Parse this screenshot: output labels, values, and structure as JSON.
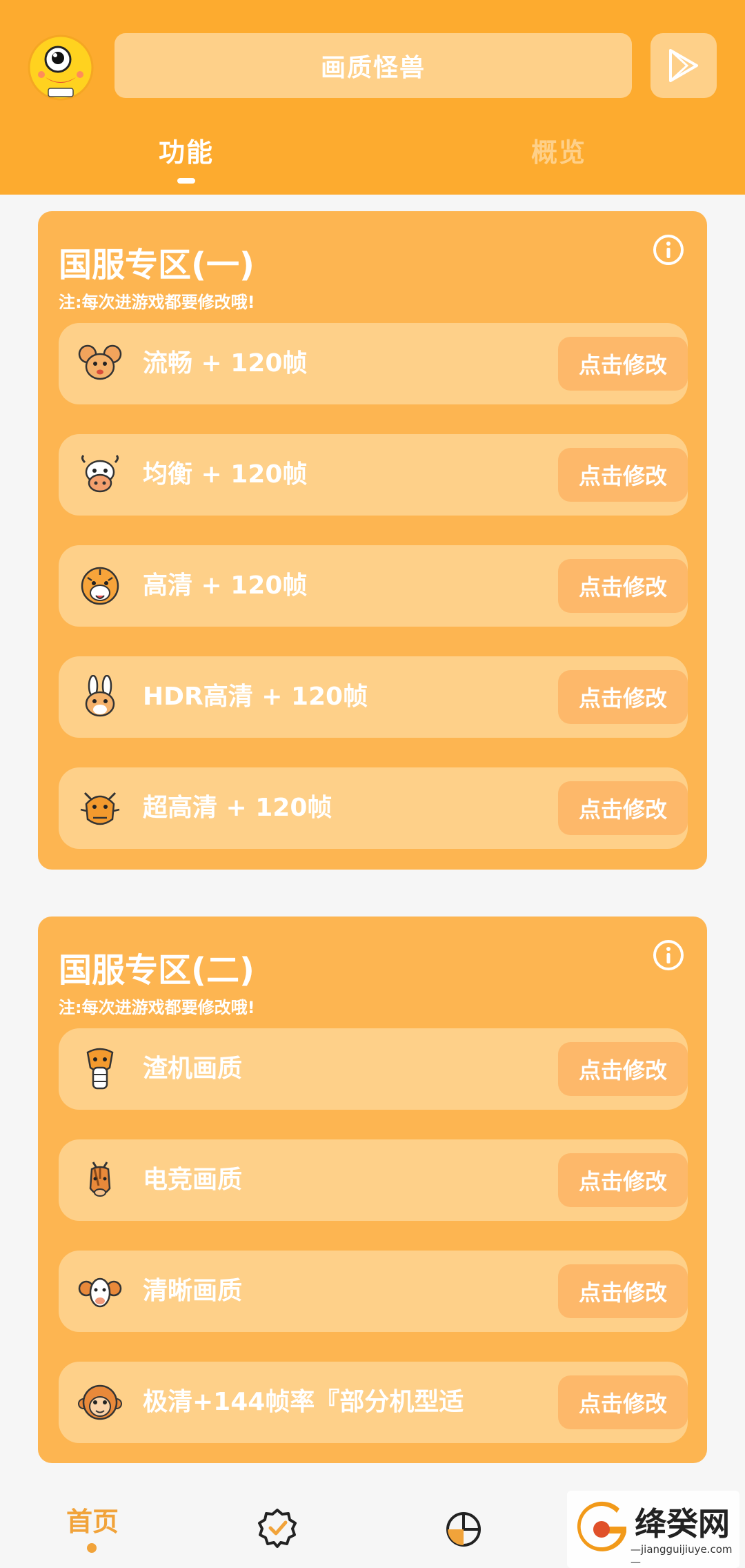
{
  "header": {
    "title": "画质怪兽",
    "tabs": [
      {
        "label": "功能",
        "active": true
      },
      {
        "label": "概览",
        "active": false
      }
    ],
    "accent_color": "#fdab2f"
  },
  "sections": [
    {
      "title": "国服专区(一)",
      "note": "注:每次进游戏都要修改哦!",
      "items": [
        {
          "label": "流畅 + 120帧",
          "icon": "mouse-icon",
          "button": "点击修改"
        },
        {
          "label": "均衡 + 120帧",
          "icon": "cow-icon",
          "button": "点击修改"
        },
        {
          "label": "高清 + 120帧",
          "icon": "tiger-icon",
          "button": "点击修改"
        },
        {
          "label": "HDR高清 + 120帧",
          "icon": "rabbit-icon",
          "button": "点击修改"
        },
        {
          "label": "超高清 + 120帧",
          "icon": "dragon-icon",
          "button": "点击修改"
        }
      ]
    },
    {
      "title": "国服专区(二)",
      "note": "注:每次进游戏都要修改哦!",
      "items": [
        {
          "label": "渣机画质",
          "icon": "snake-icon",
          "button": "点击修改"
        },
        {
          "label": "电竞画质",
          "icon": "horse-icon",
          "button": "点击修改"
        },
        {
          "label": "清晰画质",
          "icon": "ram-icon",
          "button": "点击修改"
        },
        {
          "label": "极清+144帧率『部分机型适",
          "icon": "monkey-icon",
          "button": "点击修改"
        }
      ]
    }
  ],
  "bottom_nav": {
    "home_label": "首页",
    "items": [
      "home",
      "verified-badge-icon",
      "pie-chart-icon"
    ]
  },
  "watermark": {
    "brand": "绛癸网",
    "url": "—jiangguijiuye.com—"
  }
}
